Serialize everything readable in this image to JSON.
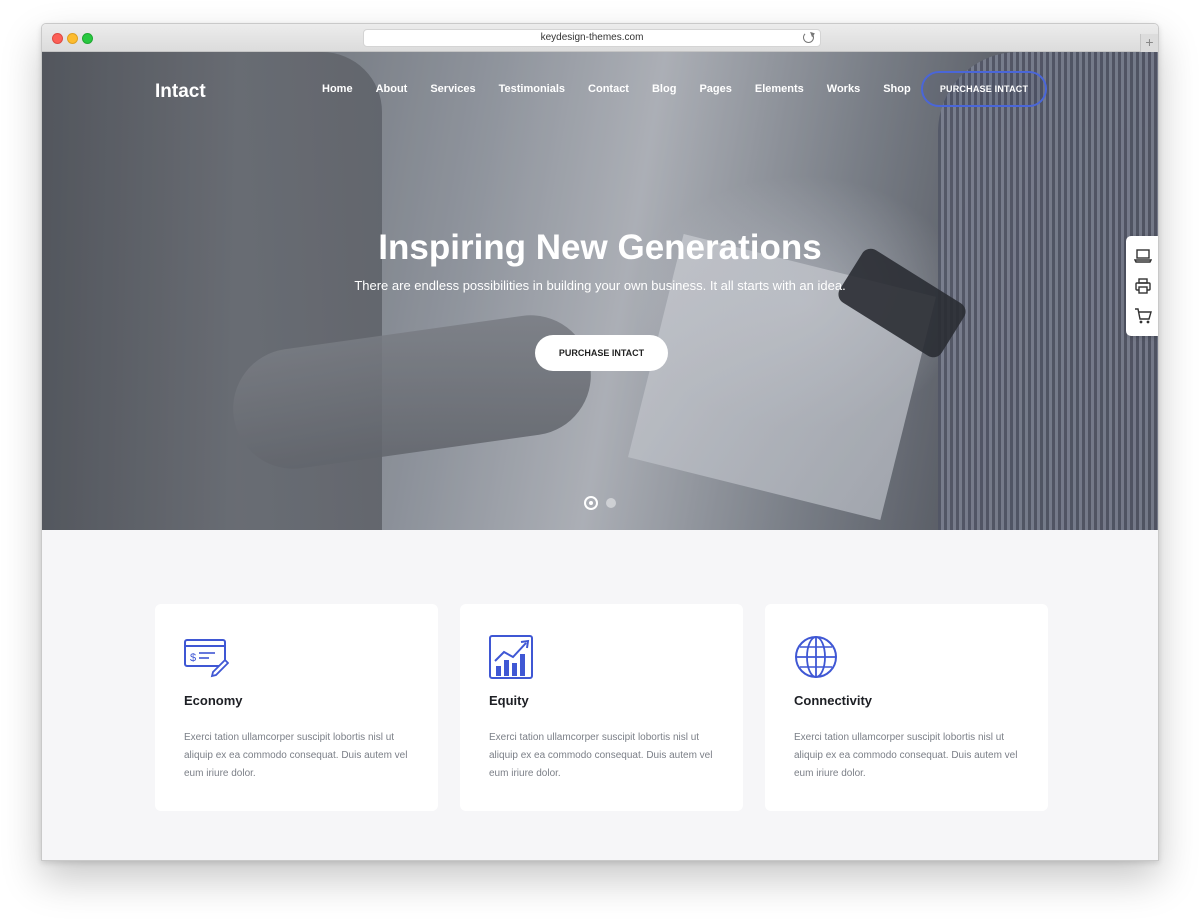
{
  "browser": {
    "url": "keydesign-themes.com"
  },
  "header": {
    "logo": "Intact",
    "nav": [
      "Home",
      "About",
      "Services",
      "Testimonials",
      "Contact",
      "Blog",
      "Pages",
      "Elements",
      "Works",
      "Shop"
    ],
    "cta_label": "PURCHASE INTACT"
  },
  "hero": {
    "title": "Inspiring New Generations",
    "subtitle": "There are endless possibilities in building your own business. It all starts with an idea.",
    "button_label": "PURCHASE INTACT",
    "slides_total": 2,
    "slide_active": 1
  },
  "side_dock": {
    "icons": [
      "laptop-icon",
      "printer-icon",
      "cart-icon"
    ]
  },
  "features": [
    {
      "icon": "check-icon",
      "title": "Economy",
      "text": "Exerci tation ullamcorper suscipit lobortis nisl ut aliquip ex ea commodo consequat. Duis autem vel eum iriure dolor."
    },
    {
      "icon": "chart-growth-icon",
      "title": "Equity",
      "text": "Exerci tation ullamcorper suscipit lobortis nisl ut aliquip ex ea commodo consequat. Duis autem vel eum iriure dolor."
    },
    {
      "icon": "globe-icon",
      "title": "Connectivity",
      "text": "Exerci tation ullamcorper suscipit lobortis nisl ut aliquip ex ea commodo consequat. Duis autem vel eum iriure dolor."
    }
  ],
  "colors": {
    "accent": "#3f57d4",
    "page_bg": "#f6f6f8",
    "card_bg": "#ffffff"
  }
}
